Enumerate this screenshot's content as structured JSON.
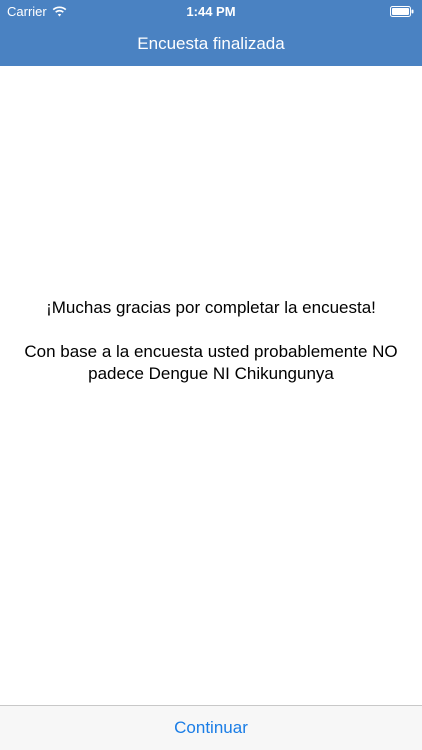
{
  "status_bar": {
    "carrier": "Carrier",
    "time": "1:44 PM",
    "wifi_icon": "wifi-icon",
    "battery_icon": "battery-icon"
  },
  "navigation": {
    "title": "Encuesta finalizada"
  },
  "content": {
    "thanks_text": "¡Muchas gracias por completar la encuesta!",
    "result_text": "Con base a la encuesta usted probablemente NO padece Dengue NI Chikungunya"
  },
  "toolbar": {
    "continue_label": "Continuar"
  },
  "colors": {
    "nav_background": "#4a82c2",
    "button_text": "#1a7de6",
    "toolbar_background": "#f7f7f7"
  }
}
